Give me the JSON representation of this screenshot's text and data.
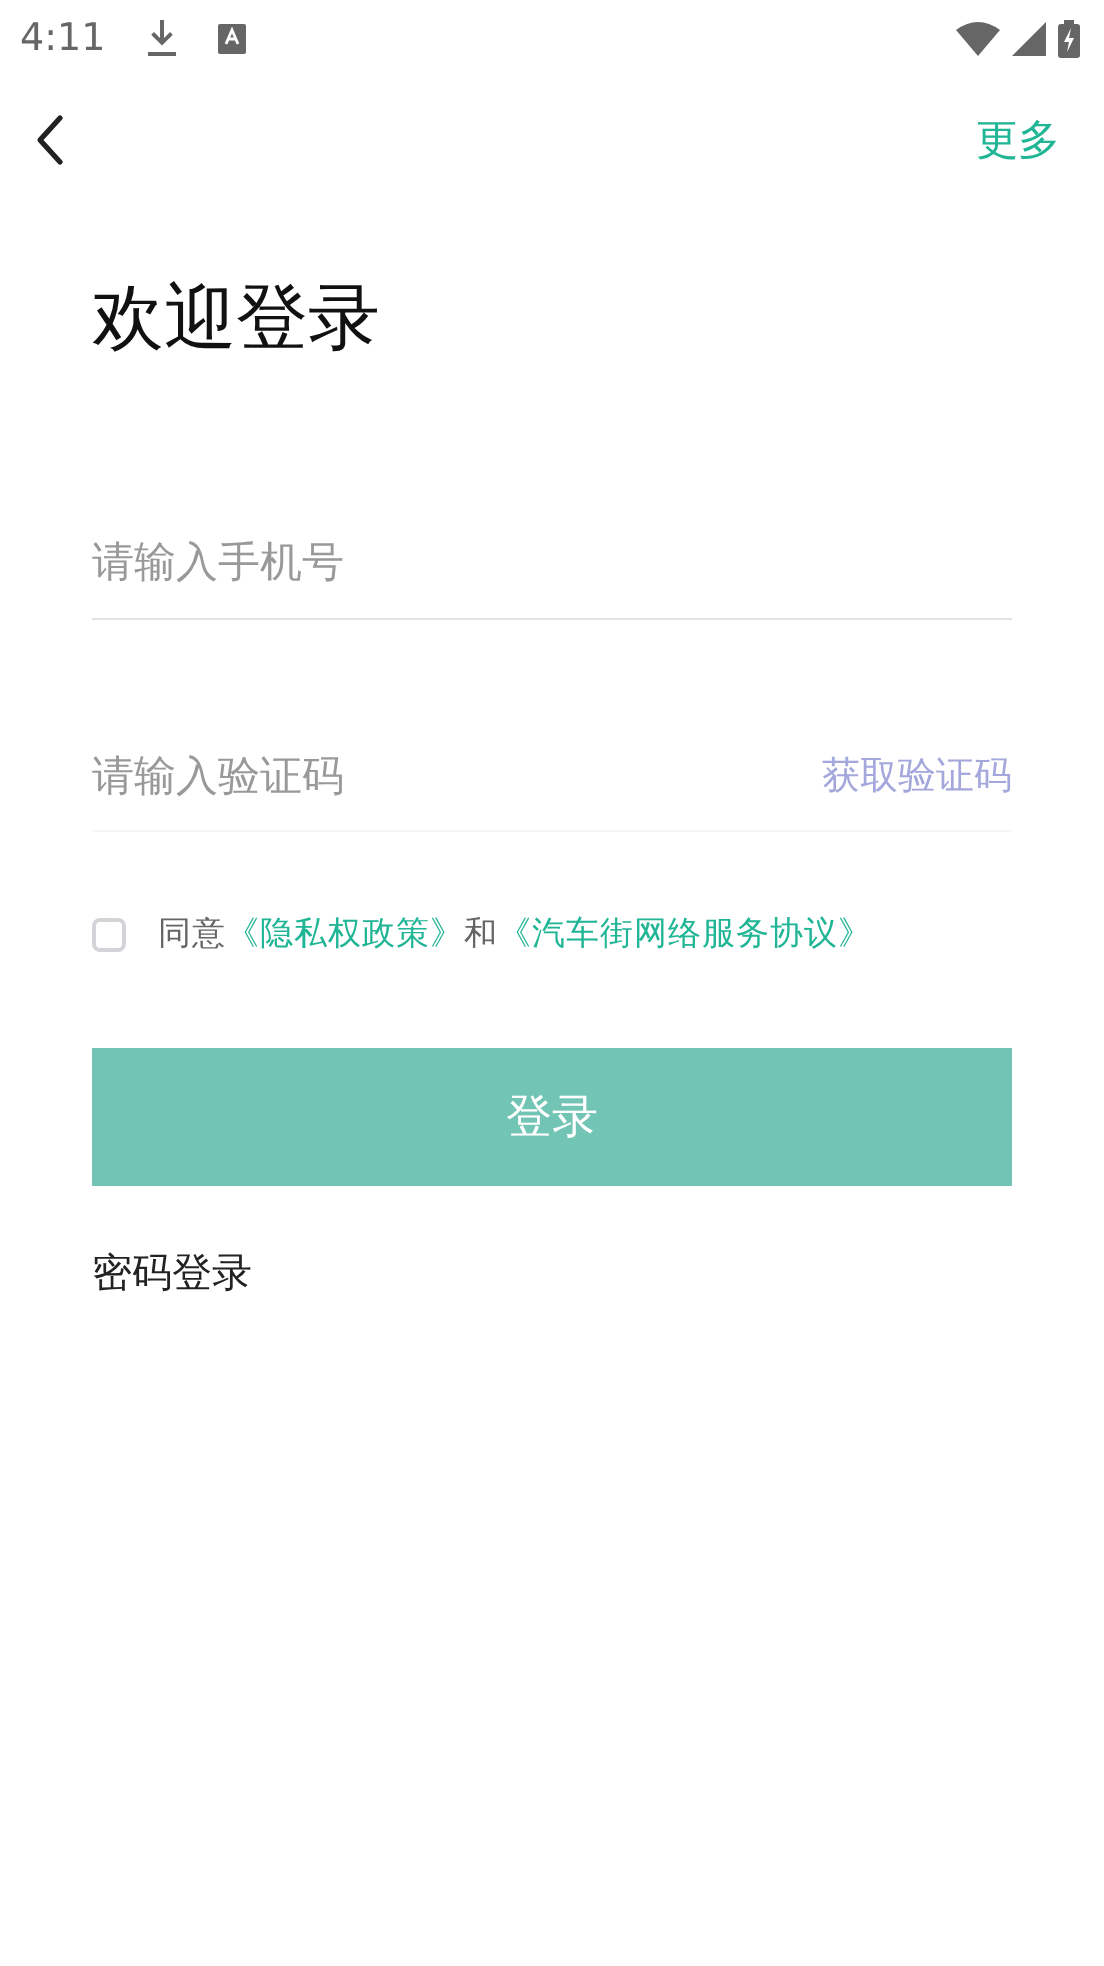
{
  "status_bar": {
    "time": "4:11"
  },
  "header": {
    "more": "更多"
  },
  "title": "欢迎登录",
  "phone_field": {
    "placeholder": "请输入手机号"
  },
  "code_field": {
    "placeholder": "请输入验证码",
    "action": "获取验证码"
  },
  "agreement": {
    "checked": false,
    "parts": [
      {
        "kind": "text",
        "text": "同意"
      },
      {
        "kind": "link",
        "text": "《隐私权政策》"
      },
      {
        "kind": "text",
        "text": "和"
      },
      {
        "kind": "link",
        "text": "《汽车街网络服务协议》"
      }
    ]
  },
  "login_button": "登录",
  "password_login": "密码登录"
}
